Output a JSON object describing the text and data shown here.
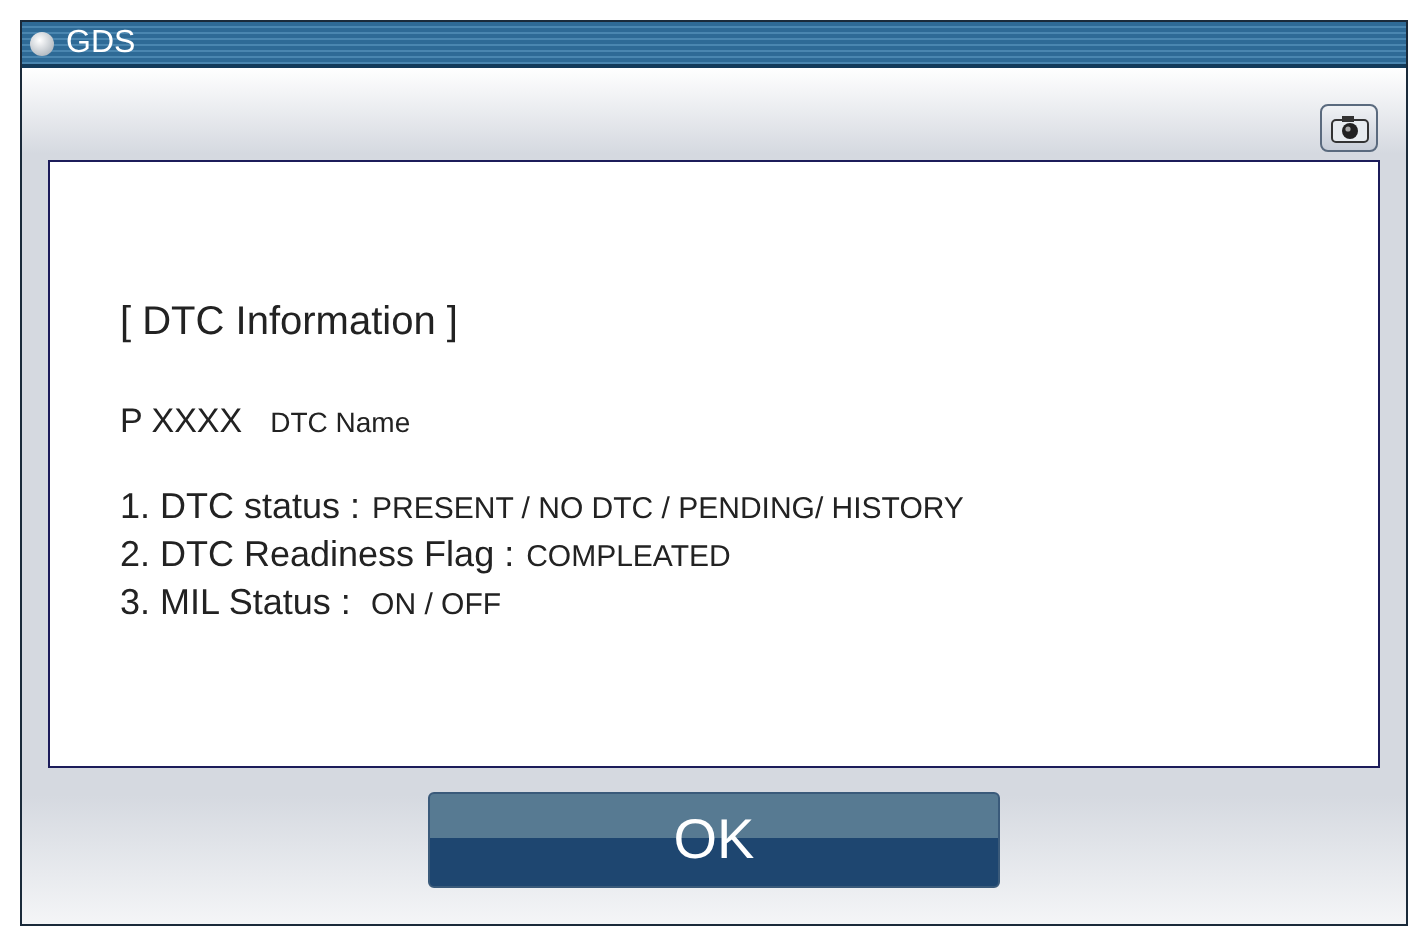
{
  "window": {
    "title": "GDS"
  },
  "heading": "[ DTC Information ]",
  "dtc": {
    "code": "P XXXX",
    "name": "DTC Name"
  },
  "items": [
    {
      "label": "1. DTC status :",
      "value": "PRESENT / NO DTC / PENDING/ HISTORY"
    },
    {
      "label": "2. DTC Readiness Flag :",
      "value": "COMPLEATED"
    },
    {
      "label": "3. MIL Status :",
      "value": " ON / OFF"
    }
  ],
  "buttons": [
    "OK"
  ]
}
